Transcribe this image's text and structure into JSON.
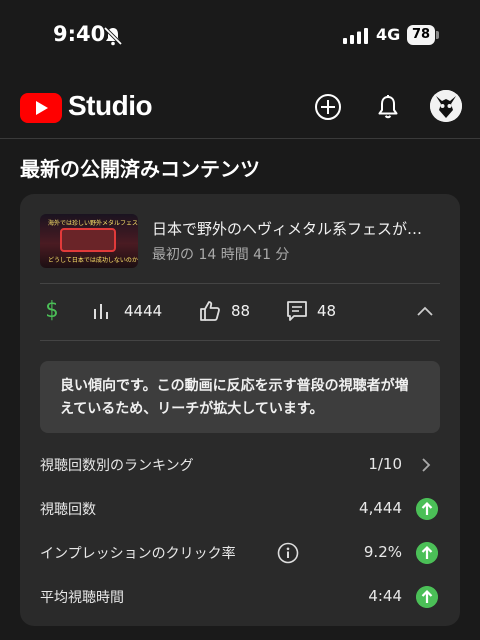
{
  "status_bar": {
    "time": "9:40",
    "network": "4G",
    "battery": "78"
  },
  "header": {
    "app_name": "Studio"
  },
  "section": {
    "title": "最新の公開済みコンテンツ"
  },
  "video": {
    "thumbnail_caption_top": "海外では珍しい野外メタルフェス",
    "thumbnail_caption_bottom": "どうして日本では成功しないのか？",
    "title": "日本で野外のヘヴィメタル系フェスが…",
    "subtitle": "最初の 14 時間 41 分"
  },
  "stats": {
    "views": "4444",
    "likes": "88",
    "comments": "48"
  },
  "insight": {
    "text": "良い傾向です。この動画に反応を示す普段の視聴者が増えているため、リーチが拡大しています。"
  },
  "metrics": [
    {
      "label": "視聴回数別のランキング",
      "value": "1/10"
    },
    {
      "label": "視聴回数",
      "value": "4,444"
    },
    {
      "label": "インプレッションのクリック率",
      "value": "9.2%"
    },
    {
      "label": "平均視聴時間",
      "value": "4:44"
    }
  ],
  "colors": {
    "background": "#1a1a1a",
    "card": "#2a2a2a",
    "accent_green": "#4bbf57",
    "youtube_red": "#ff0000"
  }
}
